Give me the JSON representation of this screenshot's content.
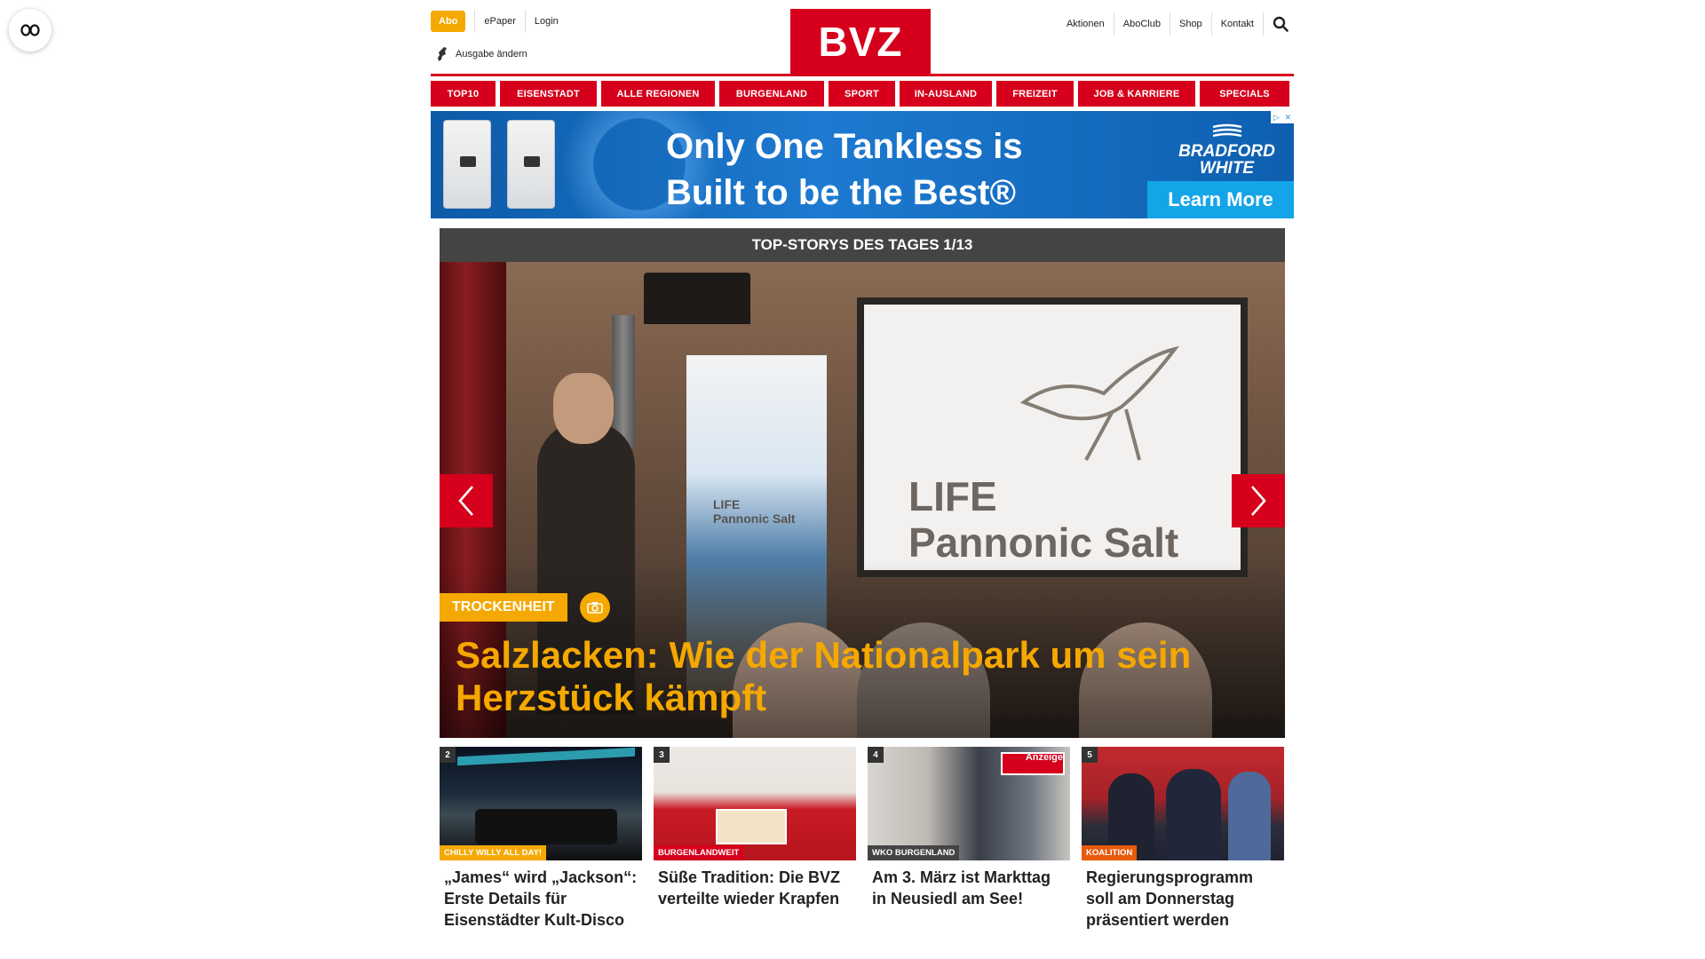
{
  "reader": {
    "icon": "reader-mode-icon"
  },
  "header": {
    "abo_label": "Abo",
    "epaper_label": "ePaper",
    "login_label": "Login",
    "ausgabe_label": "Ausgabe ändern",
    "logo_text": "BVZ",
    "right_links": [
      "Aktionen",
      "AboClub",
      "Shop",
      "Kontakt"
    ],
    "search_icon": "search-icon"
  },
  "nav": {
    "items": [
      "TOP10",
      "EISENSTADT",
      "ALLE REGIONEN",
      "BURGENLAND",
      "SPORT",
      "IN-AUSLAND",
      "FREIZEIT",
      "JOB & KARRIERE",
      "SPECIALS"
    ]
  },
  "ad": {
    "headline_line1": "Only One Tankless is",
    "headline_line2": "Built to be the Best®",
    "brand_line1": "BRADFORD",
    "brand_line2": "WHITE",
    "cta": "Learn More",
    "accent": "#14a5e8"
  },
  "hero": {
    "header": "TOP-STORYS DES TAGES 1/13",
    "category": "TROCKENHEIT",
    "title": "Salzlacken: Wie der Nationalpark um sein Herzstück kämpft",
    "banner_text_line1": "LIFE",
    "banner_text_line2": "Pannonic Salt",
    "screen_line1": "LIFE",
    "screen_line2": "Pannonic Salt",
    "photo_icon": "camera-icon"
  },
  "teasers": [
    {
      "num": "2",
      "tag": "CHILLY WILLY ALL DAY!",
      "tag_color": "#f5a800",
      "title": "„James“ wird „Jackson“: Erste Details für Eisenstädter Kult-Disco"
    },
    {
      "num": "3",
      "tag": "BURGENLANDWEIT",
      "tag_color": "#d6001c",
      "title": "Süße Tradition: Die BVZ verteilte wieder Krapfen"
    },
    {
      "num": "4",
      "tag": "WKO BURGENLAND",
      "tag_color": "#444444",
      "title": "Am 3. März ist Markttag in Neusiedl am See!",
      "anzeige": "Anzeige"
    },
    {
      "num": "5",
      "tag": "KOALITION",
      "tag_color": "#e85a0c",
      "title": "Regierungsprogramm soll am Donnerstag präsentiert werden"
    }
  ],
  "colors": {
    "brand_red": "#d6001c",
    "accent_yellow": "#f5a800"
  }
}
